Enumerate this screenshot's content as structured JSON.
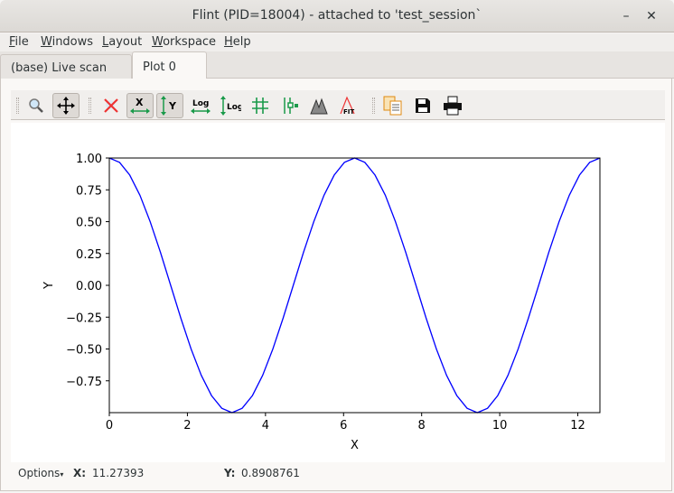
{
  "window": {
    "title": "Flint (PID=18004) - attached to 'test_session`",
    "minimize_icon": "minimize-icon",
    "close_icon": "close-icon"
  },
  "menu": [
    {
      "label": "File",
      "u": "F",
      "rest": "ile"
    },
    {
      "label": "Windows",
      "u": "W",
      "rest": "indows"
    },
    {
      "label": "Layout",
      "u": "L",
      "rest": "ayout"
    },
    {
      "label": "Workspace",
      "u": "W",
      "rest": "orkspace"
    },
    {
      "label": "Help",
      "u": "H",
      "rest": "elp"
    }
  ],
  "tabs": [
    {
      "label": "(base) Live scan",
      "active": false
    },
    {
      "label": "Plot 0",
      "active": true
    }
  ],
  "toolbar": {
    "items": [
      "zoom-icon",
      "pan-icon",
      "reset-zoom-icon",
      "x-autoscale-icon",
      "y-autoscale-icon",
      "x-log-icon",
      "y-log-icon",
      "grid-icon",
      "curve-style-icon",
      "peak-icon",
      "fit-icon",
      "copy-icon",
      "save-icon",
      "print-icon"
    ],
    "labels": {
      "x": "X",
      "y": "Y",
      "log": "Log",
      "fit": "FIT"
    },
    "active": [
      "pan-icon",
      "x-autoscale-icon",
      "y-autoscale-icon"
    ]
  },
  "status": {
    "options": "Options",
    "x_label": "X:",
    "x_value": "11.27393",
    "y_label": "Y:",
    "y_value": "0.8908761"
  },
  "chart_data": {
    "type": "line",
    "xlabel": "X",
    "ylabel": "Y",
    "xlim": [
      0,
      12.566
    ],
    "ylim": [
      -1,
      1
    ],
    "xticks": [
      "0",
      "2",
      "4",
      "6",
      "8",
      "10",
      "12"
    ],
    "yticks": [
      "1.00",
      "0.75",
      "0.50",
      "0.25",
      "0.00",
      "−0.25",
      "−0.50",
      "−0.75"
    ],
    "grid": false,
    "color": "#0000ff",
    "x": [
      0,
      0.262,
      0.524,
      0.785,
      1.047,
      1.309,
      1.571,
      1.833,
      2.094,
      2.356,
      2.618,
      2.88,
      3.142,
      3.403,
      3.665,
      3.927,
      4.189,
      4.451,
      4.712,
      4.974,
      5.236,
      5.498,
      5.76,
      6.021,
      6.283,
      6.545,
      6.807,
      7.069,
      7.33,
      7.592,
      7.854,
      8.116,
      8.378,
      8.639,
      8.901,
      9.163,
      9.425,
      9.687,
      9.948,
      10.21,
      10.472,
      10.734,
      10.996,
      11.257,
      11.519,
      11.781,
      12.043,
      12.305,
      12.566
    ],
    "y": [
      1,
      0.966,
      0.866,
      0.707,
      0.5,
      0.259,
      0,
      -0.259,
      -0.5,
      -0.707,
      -0.866,
      -0.966,
      -1,
      -0.966,
      -0.866,
      -0.707,
      -0.5,
      -0.259,
      0,
      0.259,
      0.5,
      0.707,
      0.866,
      0.966,
      1,
      0.966,
      0.866,
      0.707,
      0.5,
      0.259,
      0,
      -0.259,
      -0.5,
      -0.707,
      -0.866,
      -0.966,
      -1,
      -0.966,
      -0.866,
      -0.707,
      -0.5,
      -0.259,
      0,
      0.259,
      0.5,
      0.707,
      0.866,
      0.966,
      1
    ]
  }
}
